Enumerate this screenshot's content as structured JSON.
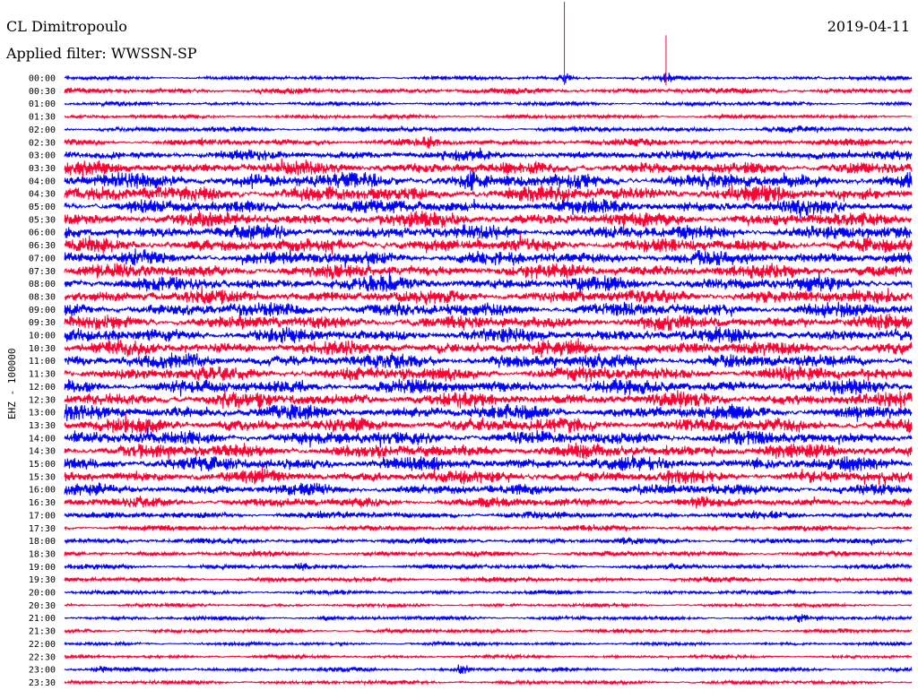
{
  "header": {
    "station": "CL Dimitropoulo",
    "filter": "Applied filter: WWSSN-SP",
    "date": "2019-04-11"
  },
  "chart_data": {
    "type": "line",
    "title": "CL Dimitropoulo",
    "subtitle": "Applied filter: WWSSN-SP",
    "date": "2019-04-11",
    "ylabel": "EHZ - 100000",
    "xlabel": "",
    "rows": [
      "00:00",
      "00:30",
      "01:00",
      "01:30",
      "02:00",
      "02:30",
      "03:00",
      "03:30",
      "04:00",
      "04:30",
      "05:00",
      "05:30",
      "06:00",
      "06:30",
      "07:00",
      "07:30",
      "08:00",
      "08:30",
      "09:00",
      "09:30",
      "10:00",
      "10:30",
      "11:00",
      "11:30",
      "12:00",
      "12:30",
      "13:00",
      "13:30",
      "14:00",
      "14:30",
      "15:00",
      "15:30",
      "16:00",
      "16:30",
      "17:00",
      "17:30",
      "18:00",
      "18:30",
      "19:00",
      "19:30",
      "20:00",
      "20:30",
      "21:00",
      "21:30",
      "22:00",
      "22:30",
      "23:00",
      "23:30"
    ],
    "row_amplitude": [
      0.3,
      0.4,
      0.3,
      0.3,
      0.4,
      0.5,
      0.7,
      0.9,
      1.1,
      1.1,
      1.0,
      1.0,
      1.0,
      1.0,
      1.0,
      1.0,
      1.0,
      1.0,
      1.0,
      1.0,
      1.0,
      1.0,
      1.0,
      1.0,
      1.0,
      1.0,
      1.0,
      1.0,
      1.0,
      1.0,
      1.0,
      0.9,
      0.8,
      0.7,
      0.5,
      0.4,
      0.4,
      0.4,
      0.35,
      0.35,
      0.3,
      0.25,
      0.3,
      0.3,
      0.25,
      0.25,
      0.3,
      0.3
    ],
    "colors": [
      "#0000ff",
      "#ff0033"
    ],
    "background": "#ffffff",
    "events": [
      {
        "row": "00:00",
        "time_fraction": 0.59,
        "scale": 5.0
      },
      {
        "row": "00:00",
        "time_fraction": 0.71,
        "scale": 2.8
      },
      {
        "row": "00:30",
        "time_fraction": 0.2,
        "scale": 1.5
      },
      {
        "row": "02:30",
        "time_fraction": 0.43,
        "scale": 2.0
      },
      {
        "row": "04:00",
        "time_fraction": 0.48,
        "scale": 1.8
      },
      {
        "row": "18:00",
        "time_fraction": 0.07,
        "scale": 1.8
      },
      {
        "row": "18:00",
        "time_fraction": 0.66,
        "scale": 2.0
      },
      {
        "row": "19:00",
        "time_fraction": 0.28,
        "scale": 2.0
      },
      {
        "row": "21:00",
        "time_fraction": 0.31,
        "scale": 2.2
      },
      {
        "row": "21:00",
        "time_fraction": 0.87,
        "scale": 2.6
      },
      {
        "row": "23:00",
        "time_fraction": 0.04,
        "scale": 3.0
      },
      {
        "row": "23:00",
        "time_fraction": 0.47,
        "scale": 4.0
      },
      {
        "row": "23:30",
        "time_fraction": 0.47,
        "scale": 3.0
      }
    ]
  }
}
